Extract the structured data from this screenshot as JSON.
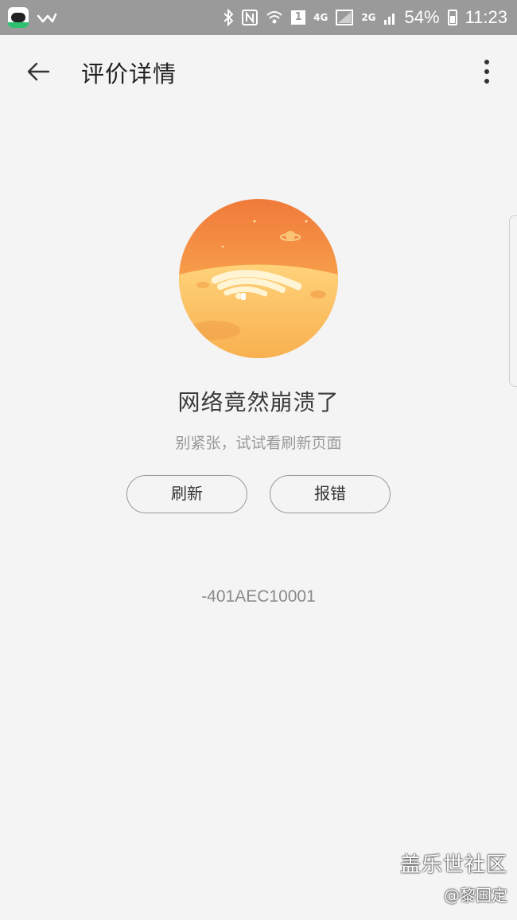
{
  "status_bar": {
    "network": "4G",
    "network2": "2G",
    "sim_badge": "1",
    "battery": "54%",
    "time": "11:23"
  },
  "app_bar": {
    "title": "评价详情"
  },
  "error_page": {
    "headline": "网络竟然崩溃了",
    "subline": "别紧张，试试看刷新页面",
    "refresh_label": "刷新",
    "report_label": "报错",
    "error_code": "-401AEC10001"
  },
  "watermark": {
    "line1": "盖乐世社区",
    "line2": "@黎国定"
  },
  "colors": {
    "background": "#f4f4f4",
    "status_bar": "#9a9a9a",
    "illustration_top": "#f07a3a",
    "illustration_bottom": "#ffd27a"
  }
}
